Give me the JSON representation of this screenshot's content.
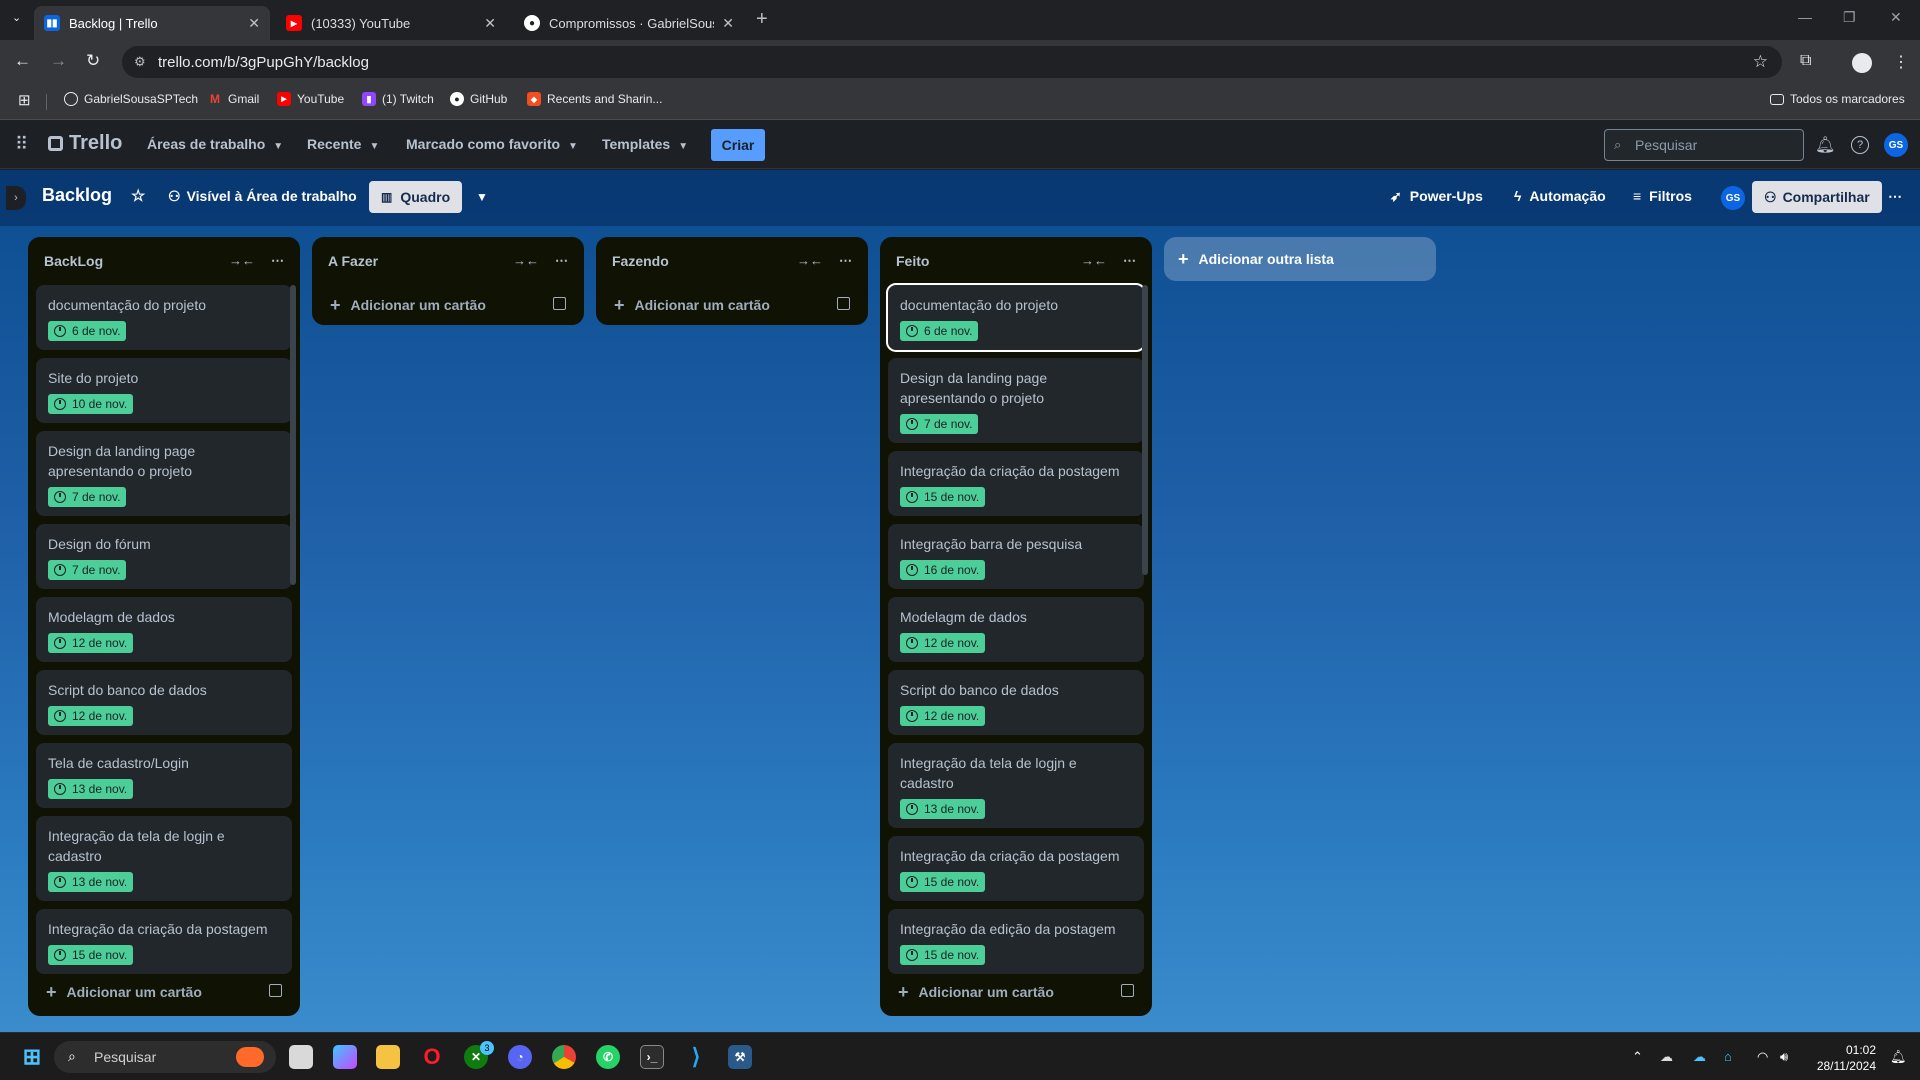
{
  "browser": {
    "tabs": [
      {
        "title": "Backlog | Trello",
        "icon": "trello-icon",
        "active": true
      },
      {
        "title": "(10333) YouTube",
        "icon": "youtube-icon",
        "active": false
      },
      {
        "title": "Compromissos · GabrielSousaSPTech",
        "icon": "github-icon",
        "active": false
      }
    ],
    "url": "trello.com/b/3gPupGhY/backlog",
    "bookmarks": [
      {
        "label": "GabrielSousaSPTech",
        "icon": "globe-icon"
      },
      {
        "label": "Gmail",
        "icon": "gmail-icon"
      },
      {
        "label": "YouTube",
        "icon": "youtube-icon"
      },
      {
        "label": "(1) Twitch",
        "icon": "twitch-icon"
      },
      {
        "label": "GitHub",
        "icon": "github-icon"
      },
      {
        "label": "Recents and Sharin...",
        "icon": "figma-icon"
      }
    ],
    "all_bookmarks": "Todos os marcadores"
  },
  "trello": {
    "logo": "Trello",
    "nav": {
      "workspaces": "Áreas de trabalho",
      "recent": "Recente",
      "starred": "Marcado como favorito",
      "templates": "Templates",
      "create": "Criar"
    },
    "search_placeholder": "Pesquisar",
    "avatar": "GS"
  },
  "board": {
    "title": "Backlog",
    "visibility": "Visível à Área de trabalho",
    "view": "Quadro",
    "powerups": "Power-Ups",
    "automation": "Automação",
    "filters": "Filtros",
    "share": "Compartilhar",
    "add_list": "Adicionar outra lista",
    "add_card": "Adicionar um cartão",
    "lists": [
      {
        "title": "BackLog",
        "cards": [
          {
            "title": "documentação do projeto",
            "due": "6 de nov."
          },
          {
            "title": "Site do projeto",
            "due": "10 de nov."
          },
          {
            "title": "Design da landing page apresentando o projeto",
            "due": "7 de nov."
          },
          {
            "title": "Design do fórum",
            "due": "7 de nov."
          },
          {
            "title": "Modelagm de dados",
            "due": "12 de nov."
          },
          {
            "title": "Script do banco de dados",
            "due": "12 de nov."
          },
          {
            "title": "Tela de cadastro/Login",
            "due": "13 de nov."
          },
          {
            "title": "Integração da tela de logjn e cadastro",
            "due": "13 de nov."
          },
          {
            "title": "Integração da criação da postagem",
            "due": "15 de nov."
          }
        ]
      },
      {
        "title": "A Fazer",
        "cards": []
      },
      {
        "title": "Fazendo",
        "cards": []
      },
      {
        "title": "Feito",
        "cards": [
          {
            "title": "documentação do projeto",
            "due": "6 de nov."
          },
          {
            "title": "Design da landing page apresentando o projeto",
            "due": "7 de nov."
          },
          {
            "title": "Integração da criação da postagem",
            "due": "15 de nov."
          },
          {
            "title": "Integração barra de pesquisa",
            "due": "16 de nov."
          },
          {
            "title": "Modelagm de dados",
            "due": "12 de nov."
          },
          {
            "title": "Script do banco de dados",
            "due": "12 de nov."
          },
          {
            "title": "Integração da tela de logjn e cadastro",
            "due": "13 de nov."
          },
          {
            "title": "Integração da criação da postagem",
            "due": "15 de nov."
          },
          {
            "title": "Integração da edição da postagem",
            "due": "15 de nov."
          }
        ]
      }
    ]
  },
  "taskbar": {
    "search": "Pesquisar",
    "time": "01:02",
    "date": "28/11/2024",
    "badge": "3"
  },
  "colors": {
    "due_badge": "#4bce97",
    "create_button": "#579dff",
    "list_bg": "#101204",
    "card_bg": "#22272b"
  }
}
